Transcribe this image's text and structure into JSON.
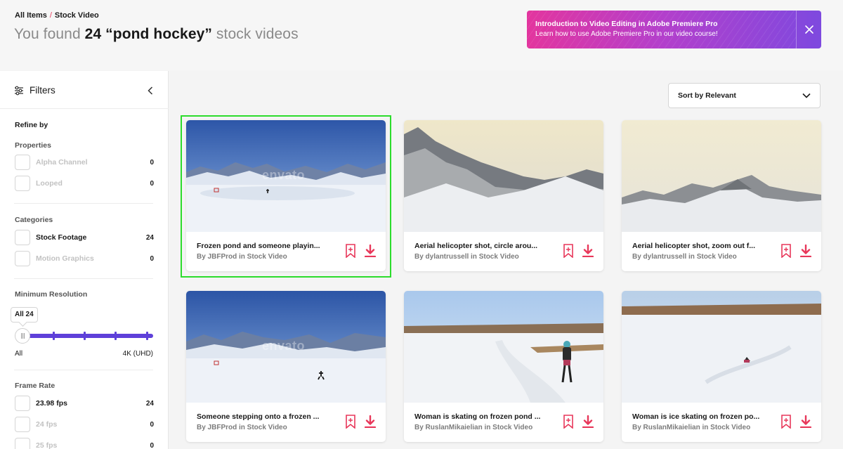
{
  "breadcrumb": {
    "root": "All Items",
    "separator": "/",
    "current": "Stock Video"
  },
  "heading": {
    "prefix": "You found ",
    "count": "24",
    "query": "“pond hockey”",
    "suffix": " stock videos"
  },
  "promo": {
    "title": "Introduction to Video Editing in Adobe Premiere Pro",
    "subtitle": "Learn how to use Adobe Premiere Pro in our video course!"
  },
  "filters": {
    "label": "Filters",
    "refine_by": "Refine by",
    "properties": {
      "title": "Properties",
      "items": [
        {
          "label": "Alpha Channel",
          "count": "0"
        },
        {
          "label": "Looped",
          "count": "0"
        }
      ]
    },
    "categories": {
      "title": "Categories",
      "items": [
        {
          "label": "Stock Footage",
          "count": "24"
        },
        {
          "label": "Motion Graphics",
          "count": "0"
        }
      ]
    },
    "resolution": {
      "title": "Minimum Resolution",
      "tooltip": "All 24",
      "min_label": "All",
      "max_label": "4K (UHD)",
      "value": 0
    },
    "frame_rate": {
      "title": "Frame Rate",
      "items": [
        {
          "label": "23.98 fps",
          "count": "24"
        },
        {
          "label": "24 fps",
          "count": "0"
        },
        {
          "label": "25 fps",
          "count": "0"
        }
      ]
    }
  },
  "sort": {
    "label": "Sort by Relevant"
  },
  "cards": [
    {
      "title": "Frozen pond and someone playin...",
      "author": "JBFProd",
      "category": "Stock Video",
      "meta": "By JBFProd in Stock Video",
      "watermark": "envato"
    },
    {
      "title": "Aerial helicopter shot, circle arou...",
      "author": "dylantrussell",
      "category": "Stock Video",
      "meta": "By dylantrussell in Stock Video"
    },
    {
      "title": "Aerial helicopter shot, zoom out f...",
      "author": "dylantrussell",
      "category": "Stock Video",
      "meta": "By dylantrussell in Stock Video"
    },
    {
      "title": "Someone stepping onto a frozen ...",
      "author": "JBFProd",
      "category": "Stock Video",
      "meta": "By JBFProd in Stock Video",
      "watermark": "envato"
    },
    {
      "title": "Woman is skating on frozen pond ...",
      "author": "RuslanMikaielian",
      "category": "Stock Video",
      "meta": "By RuslanMikaielian in Stock Video"
    },
    {
      "title": "Woman is ice skating on frozen po...",
      "author": "RuslanMikaielian",
      "category": "Stock Video",
      "meta": "By RuslanMikaielian in Stock Video"
    }
  ],
  "icons": {
    "filters": "sliders-icon",
    "collapse": "chevron-left-icon",
    "close": "close-icon",
    "sort": "chevron-down-icon",
    "bookmark": "bookmark-add-icon",
    "download": "download-icon"
  },
  "colors": {
    "accent_red": "#e8375a",
    "slider": "#5e40d9",
    "promo_start": "#e3359e",
    "promo_end": "#7e49df",
    "selection": "#2cdc2c"
  }
}
